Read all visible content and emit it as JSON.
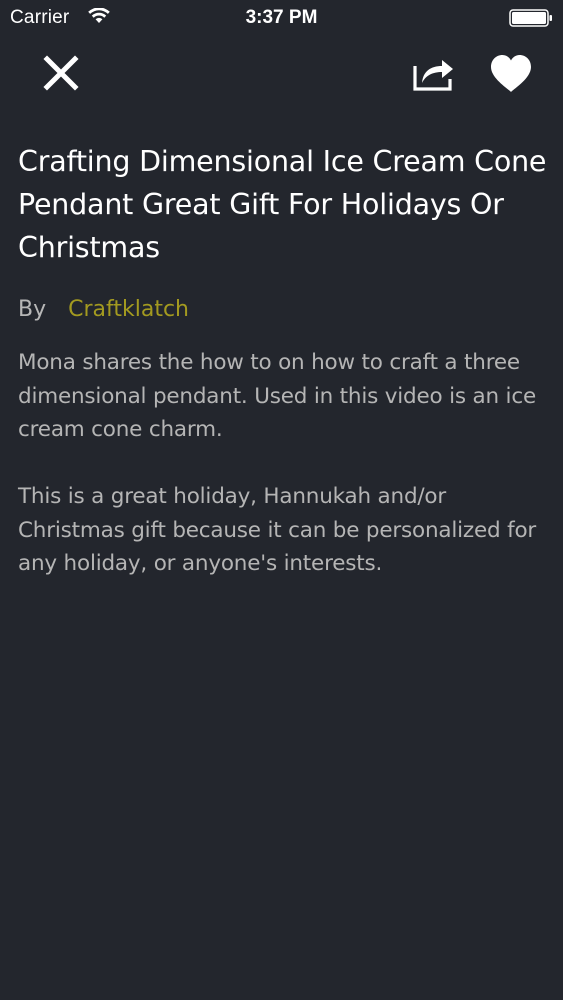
{
  "status_bar": {
    "carrier": "Carrier",
    "time": "3:37 PM"
  },
  "nav": {
    "close_icon": "close-icon",
    "share_icon": "share-icon",
    "favorite_icon": "heart-icon"
  },
  "article": {
    "title": "Crafting Dimensional Ice Cream Cone Pendant Great Gift For Holidays Or Christmas",
    "by_label": "By",
    "author": "Craftklatch",
    "paragraphs": [
      "Mona shares the how to on how to craft a three dimensional pendant. Used in this video is an ice cream cone charm.",
      "This is a great holiday, Hannukah and/or Christmas gift because it can be personalized for any holiday, or anyone's interests."
    ]
  },
  "colors": {
    "background": "#23262d",
    "author_accent": "#a39a20",
    "body_text": "#b5b5b5",
    "title_text": "#ffffff"
  }
}
